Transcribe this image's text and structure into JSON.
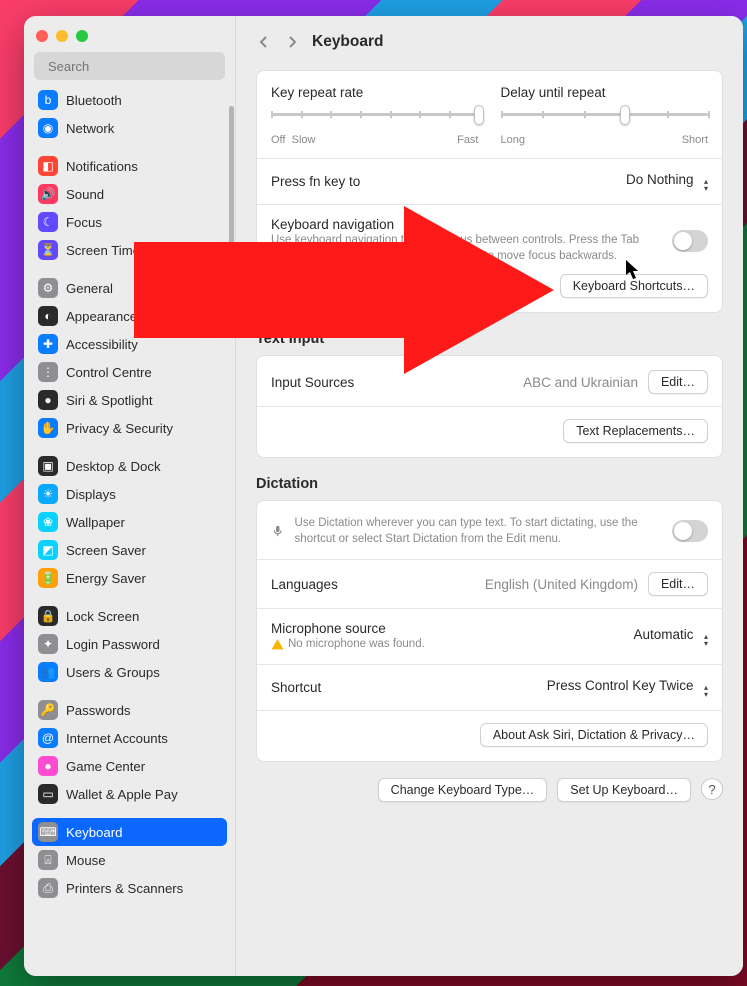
{
  "header": {
    "title": "Keyboard"
  },
  "search": {
    "placeholder": "Search"
  },
  "sidebar": {
    "groups": [
      [
        {
          "label": "Bluetooth",
          "color": "#0a7cff",
          "glyph": "b"
        },
        {
          "label": "Network",
          "color": "#0a7cff",
          "glyph": "◉"
        }
      ],
      [
        {
          "label": "Notifications",
          "color": "#ff4538",
          "glyph": "◧"
        },
        {
          "label": "Sound",
          "color": "#ff3860",
          "glyph": "🔊"
        },
        {
          "label": "Focus",
          "color": "#6049ff",
          "glyph": "☾"
        },
        {
          "label": "Screen Time",
          "color": "#6049ff",
          "glyph": "⏳"
        }
      ],
      [
        {
          "label": "General",
          "color": "#8e8e93",
          "glyph": "⚙"
        },
        {
          "label": "Appearance",
          "color": "#2a2a2a",
          "glyph": "◐"
        },
        {
          "label": "Accessibility",
          "color": "#0a7cff",
          "glyph": "✚"
        },
        {
          "label": "Control Centre",
          "color": "#8e8e93",
          "glyph": "⋮"
        },
        {
          "label": "Siri & Spotlight",
          "color": "#2a2a2a",
          "glyph": "●"
        },
        {
          "label": "Privacy & Security",
          "color": "#0a7cff",
          "glyph": "✋"
        }
      ],
      [
        {
          "label": "Desktop & Dock",
          "color": "#2a2a2a",
          "glyph": "▣"
        },
        {
          "label": "Displays",
          "color": "#0aa9ff",
          "glyph": "☀"
        },
        {
          "label": "Wallpaper",
          "color": "#0ad2ff",
          "glyph": "❀"
        },
        {
          "label": "Screen Saver",
          "color": "#0ad2ff",
          "glyph": "◩"
        },
        {
          "label": "Energy Saver",
          "color": "#ff9f0a",
          "glyph": "🔋"
        }
      ],
      [
        {
          "label": "Lock Screen",
          "color": "#2a2a2a",
          "glyph": "🔒"
        },
        {
          "label": "Login Password",
          "color": "#8e8e93",
          "glyph": "✦"
        },
        {
          "label": "Users & Groups",
          "color": "#0a7cff",
          "glyph": "👥"
        }
      ],
      [
        {
          "label": "Passwords",
          "color": "#8e8e93",
          "glyph": "🔑"
        },
        {
          "label": "Internet Accounts",
          "color": "#0a7cff",
          "glyph": "@"
        },
        {
          "label": "Game Center",
          "color": "#ff4dd2",
          "glyph": "●"
        },
        {
          "label": "Wallet & Apple Pay",
          "color": "#2a2a2a",
          "glyph": "▭"
        }
      ],
      [
        {
          "label": "Keyboard",
          "color": "#8e8e93",
          "glyph": "⌨",
          "selected": true
        },
        {
          "label": "Mouse",
          "color": "#8e8e93",
          "glyph": "⍓"
        },
        {
          "label": "Printers & Scanners",
          "color": "#8e8e93",
          "glyph": "⎙"
        }
      ]
    ]
  },
  "sliders": {
    "keyRepeat": {
      "title": "Key repeat rate",
      "left": "Off",
      "mid": "Slow",
      "right": "Fast",
      "ticks": 8,
      "pos": 7
    },
    "delay": {
      "title": "Delay until repeat",
      "left": "Long",
      "right": "Short",
      "ticks": 6,
      "pos": 3
    }
  },
  "fn": {
    "label": "Press fn key to",
    "value": "Do Nothing"
  },
  "nav": {
    "title": "Keyboard navigation",
    "desc": "Use keyboard navigation to move focus between controls. Press the Tab key to move focus forwards and Shift Tab to move focus backwards.",
    "button": "Keyboard Shortcuts…"
  },
  "textInput": {
    "heading": "Text Input",
    "sources": {
      "label": "Input Sources",
      "value": "ABC and Ukrainian",
      "button": "Edit…"
    },
    "replacements": "Text Replacements…"
  },
  "dictation": {
    "heading": "Dictation",
    "desc": "Use Dictation wherever you can type text. To start dictating, use the shortcut or select Start Dictation from the Edit menu.",
    "lang": {
      "label": "Languages",
      "value": "English (United Kingdom)",
      "button": "Edit…"
    },
    "mic": {
      "label": "Microphone source",
      "value": "Automatic",
      "warn": "No microphone was found."
    },
    "shortcut": {
      "label": "Shortcut",
      "value": "Press Control Key Twice"
    },
    "about": "About Ask Siri, Dictation & Privacy…"
  },
  "bottom": {
    "change": "Change Keyboard Type…",
    "setup": "Set Up Keyboard…"
  }
}
